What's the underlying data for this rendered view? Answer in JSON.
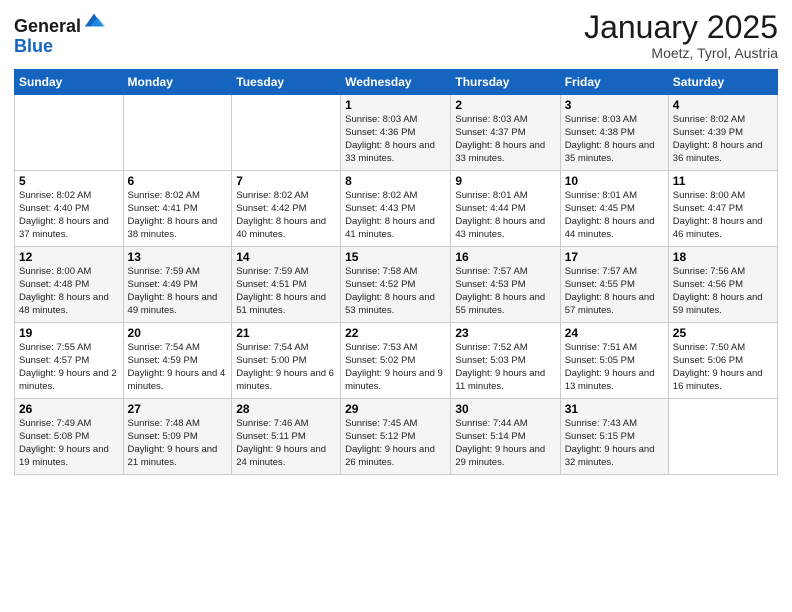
{
  "logo": {
    "general": "General",
    "blue": "Blue"
  },
  "header": {
    "month": "January 2025",
    "location": "Moetz, Tyrol, Austria"
  },
  "weekdays": [
    "Sunday",
    "Monday",
    "Tuesday",
    "Wednesday",
    "Thursday",
    "Friday",
    "Saturday"
  ],
  "weeks": [
    [
      {
        "day": "",
        "info": ""
      },
      {
        "day": "",
        "info": ""
      },
      {
        "day": "",
        "info": ""
      },
      {
        "day": "1",
        "info": "Sunrise: 8:03 AM\nSunset: 4:36 PM\nDaylight: 8 hours\nand 33 minutes."
      },
      {
        "day": "2",
        "info": "Sunrise: 8:03 AM\nSunset: 4:37 PM\nDaylight: 8 hours\nand 33 minutes."
      },
      {
        "day": "3",
        "info": "Sunrise: 8:03 AM\nSunset: 4:38 PM\nDaylight: 8 hours\nand 35 minutes."
      },
      {
        "day": "4",
        "info": "Sunrise: 8:02 AM\nSunset: 4:39 PM\nDaylight: 8 hours\nand 36 minutes."
      }
    ],
    [
      {
        "day": "5",
        "info": "Sunrise: 8:02 AM\nSunset: 4:40 PM\nDaylight: 8 hours\nand 37 minutes."
      },
      {
        "day": "6",
        "info": "Sunrise: 8:02 AM\nSunset: 4:41 PM\nDaylight: 8 hours\nand 38 minutes."
      },
      {
        "day": "7",
        "info": "Sunrise: 8:02 AM\nSunset: 4:42 PM\nDaylight: 8 hours\nand 40 minutes."
      },
      {
        "day": "8",
        "info": "Sunrise: 8:02 AM\nSunset: 4:43 PM\nDaylight: 8 hours\nand 41 minutes."
      },
      {
        "day": "9",
        "info": "Sunrise: 8:01 AM\nSunset: 4:44 PM\nDaylight: 8 hours\nand 43 minutes."
      },
      {
        "day": "10",
        "info": "Sunrise: 8:01 AM\nSunset: 4:45 PM\nDaylight: 8 hours\nand 44 minutes."
      },
      {
        "day": "11",
        "info": "Sunrise: 8:00 AM\nSunset: 4:47 PM\nDaylight: 8 hours\nand 46 minutes."
      }
    ],
    [
      {
        "day": "12",
        "info": "Sunrise: 8:00 AM\nSunset: 4:48 PM\nDaylight: 8 hours\nand 48 minutes."
      },
      {
        "day": "13",
        "info": "Sunrise: 7:59 AM\nSunset: 4:49 PM\nDaylight: 8 hours\nand 49 minutes."
      },
      {
        "day": "14",
        "info": "Sunrise: 7:59 AM\nSunset: 4:51 PM\nDaylight: 8 hours\nand 51 minutes."
      },
      {
        "day": "15",
        "info": "Sunrise: 7:58 AM\nSunset: 4:52 PM\nDaylight: 8 hours\nand 53 minutes."
      },
      {
        "day": "16",
        "info": "Sunrise: 7:57 AM\nSunset: 4:53 PM\nDaylight: 8 hours\nand 55 minutes."
      },
      {
        "day": "17",
        "info": "Sunrise: 7:57 AM\nSunset: 4:55 PM\nDaylight: 8 hours\nand 57 minutes."
      },
      {
        "day": "18",
        "info": "Sunrise: 7:56 AM\nSunset: 4:56 PM\nDaylight: 8 hours\nand 59 minutes."
      }
    ],
    [
      {
        "day": "19",
        "info": "Sunrise: 7:55 AM\nSunset: 4:57 PM\nDaylight: 9 hours\nand 2 minutes."
      },
      {
        "day": "20",
        "info": "Sunrise: 7:54 AM\nSunset: 4:59 PM\nDaylight: 9 hours\nand 4 minutes."
      },
      {
        "day": "21",
        "info": "Sunrise: 7:54 AM\nSunset: 5:00 PM\nDaylight: 9 hours\nand 6 minutes."
      },
      {
        "day": "22",
        "info": "Sunrise: 7:53 AM\nSunset: 5:02 PM\nDaylight: 9 hours\nand 9 minutes."
      },
      {
        "day": "23",
        "info": "Sunrise: 7:52 AM\nSunset: 5:03 PM\nDaylight: 9 hours\nand 11 minutes."
      },
      {
        "day": "24",
        "info": "Sunrise: 7:51 AM\nSunset: 5:05 PM\nDaylight: 9 hours\nand 13 minutes."
      },
      {
        "day": "25",
        "info": "Sunrise: 7:50 AM\nSunset: 5:06 PM\nDaylight: 9 hours\nand 16 minutes."
      }
    ],
    [
      {
        "day": "26",
        "info": "Sunrise: 7:49 AM\nSunset: 5:08 PM\nDaylight: 9 hours\nand 19 minutes."
      },
      {
        "day": "27",
        "info": "Sunrise: 7:48 AM\nSunset: 5:09 PM\nDaylight: 9 hours\nand 21 minutes."
      },
      {
        "day": "28",
        "info": "Sunrise: 7:46 AM\nSunset: 5:11 PM\nDaylight: 9 hours\nand 24 minutes."
      },
      {
        "day": "29",
        "info": "Sunrise: 7:45 AM\nSunset: 5:12 PM\nDaylight: 9 hours\nand 26 minutes."
      },
      {
        "day": "30",
        "info": "Sunrise: 7:44 AM\nSunset: 5:14 PM\nDaylight: 9 hours\nand 29 minutes."
      },
      {
        "day": "31",
        "info": "Sunrise: 7:43 AM\nSunset: 5:15 PM\nDaylight: 9 hours\nand 32 minutes."
      },
      {
        "day": "",
        "info": ""
      }
    ]
  ]
}
